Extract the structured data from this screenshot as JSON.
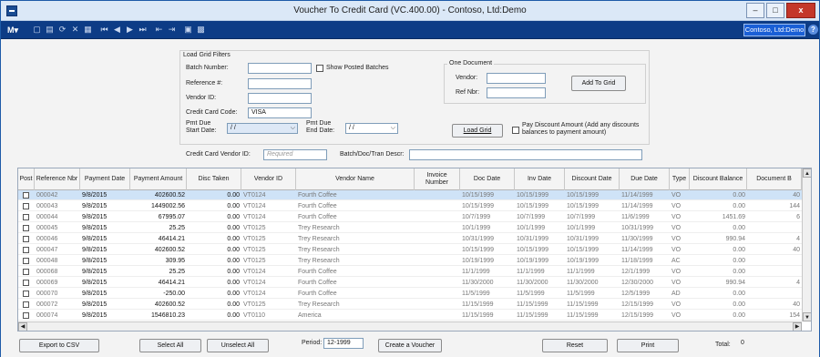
{
  "window": {
    "title": "Voucher To Credit Card (VC.400.00) - Contoso, Ltd:Demo",
    "minimize": "–",
    "maximize": "□",
    "close": "x"
  },
  "toolbar": {
    "logo": "M▾",
    "company": "Contoso, Ltd:Demo",
    "help": "?",
    "icons": [
      "new-icon",
      "save-icon",
      "refresh-icon",
      "delete-icon",
      "cancel-icon",
      "first-icon",
      "previous-icon",
      "next-icon",
      "last-icon",
      "action1-icon",
      "action2-icon",
      "report-icon",
      "export-icon"
    ]
  },
  "filters": {
    "group_label": "Load Grid Filters",
    "batch_number_label": "Batch Number:",
    "batch_number_value": "",
    "show_posted_batches_label": "Show Posted Batches",
    "reference_label": "Reference #:",
    "reference_value": "",
    "vendor_id_label": "Vendor ID:",
    "vendor_id_value": "",
    "credit_card_code_label": "Credit Card Code:",
    "credit_card_code_value": "VISA",
    "pmt_due_start_label1": "Pmt Due",
    "pmt_due_start_label2": "Start Date:",
    "pmt_due_start_value": "/ /",
    "pmt_due_end_label1": "Pmt Due",
    "pmt_due_end_label2": "End Date:",
    "pmt_due_end_value": "/ /",
    "cc_vendor_id_label": "Credit Card Vendor ID:",
    "cc_vendor_id_placeholder": "Required",
    "batch_descr_label": "Batch/Doc/Tran Descr:",
    "batch_descr_value": ""
  },
  "one_document": {
    "group_label": "One Document",
    "vendor_label": "Vendor:",
    "vendor_value": "",
    "ref_nbr_label": "Ref Nbr:",
    "ref_nbr_value": "",
    "add_to_grid": "Add To Grid"
  },
  "load_grid": "Load Grid",
  "pay_discount_label1": "Pay Discount Amount (Add any discounts",
  "pay_discount_label2": "balances to payment amount)",
  "grid": {
    "headers": [
      "Post",
      "Reference Nbr",
      "Payment Date",
      "Payment Amount",
      "Disc Taken",
      "Vendor ID",
      "Vendor Name",
      "Invoice Number",
      "Doc Date",
      "Inv Date",
      "Discount Date",
      "Due Date",
      "Type",
      "Discount Balance",
      "Document B"
    ],
    "rows": [
      {
        "ref": "000042",
        "pay_date": "9/8/2015",
        "pay_amt": "402600.52",
        "disc": "0.00",
        "vendor": "VT0124",
        "name": "Fourth Coffee",
        "inv": "",
        "doc_date": "10/15/1999",
        "inv_date": "10/15/1999",
        "disc_date": "10/15/1999",
        "due_date": "11/14/1999",
        "type": "VO",
        "disc_bal": "0.00",
        "doc_bal": "40"
      },
      {
        "ref": "000043",
        "pay_date": "9/8/2015",
        "pay_amt": "1449002.56",
        "disc": "0.00",
        "vendor": "VT0124",
        "name": "Fourth Coffee",
        "inv": "",
        "doc_date": "10/15/1999",
        "inv_date": "10/15/1999",
        "disc_date": "10/15/1999",
        "due_date": "11/14/1999",
        "type": "VO",
        "disc_bal": "0.00",
        "doc_bal": "144"
      },
      {
        "ref": "000044",
        "pay_date": "9/8/2015",
        "pay_amt": "67995.07",
        "disc": "0.00",
        "vendor": "VT0124",
        "name": "Fourth Coffee",
        "inv": "",
        "doc_date": "10/7/1999",
        "inv_date": "10/7/1999",
        "disc_date": "10/7/1999",
        "due_date": "11/6/1999",
        "type": "VO",
        "disc_bal": "1451.69",
        "doc_bal": "6"
      },
      {
        "ref": "000045",
        "pay_date": "9/8/2015",
        "pay_amt": "25.25",
        "disc": "0.00",
        "vendor": "VT0125",
        "name": "Trey Research",
        "inv": "",
        "doc_date": "10/1/1999",
        "inv_date": "10/1/1999",
        "disc_date": "10/1/1999",
        "due_date": "10/31/1999",
        "type": "VO",
        "disc_bal": "0.00",
        "doc_bal": ""
      },
      {
        "ref": "000046",
        "pay_date": "9/8/2015",
        "pay_amt": "46414.21",
        "disc": "0.00",
        "vendor": "VT0125",
        "name": "Trey Research",
        "inv": "",
        "doc_date": "10/31/1999",
        "inv_date": "10/31/1999",
        "disc_date": "10/31/1999",
        "due_date": "11/30/1999",
        "type": "VO",
        "disc_bal": "990.94",
        "doc_bal": "4"
      },
      {
        "ref": "000047",
        "pay_date": "9/8/2015",
        "pay_amt": "402600.52",
        "disc": "0.00",
        "vendor": "VT0125",
        "name": "Trey Research",
        "inv": "",
        "doc_date": "10/15/1999",
        "inv_date": "10/15/1999",
        "disc_date": "10/15/1999",
        "due_date": "11/14/1999",
        "type": "VO",
        "disc_bal": "0.00",
        "doc_bal": "40"
      },
      {
        "ref": "000048",
        "pay_date": "9/8/2015",
        "pay_amt": "309.95",
        "disc": "0.00",
        "vendor": "VT0125",
        "name": "Trey Research",
        "inv": "",
        "doc_date": "10/19/1999",
        "inv_date": "10/19/1999",
        "disc_date": "10/19/1999",
        "due_date": "11/18/1999",
        "type": "AC",
        "disc_bal": "0.00",
        "doc_bal": ""
      },
      {
        "ref": "000068",
        "pay_date": "9/8/2015",
        "pay_amt": "25.25",
        "disc": "0.00",
        "vendor": "VT0124",
        "name": "Fourth Coffee",
        "inv": "",
        "doc_date": "11/1/1999",
        "inv_date": "11/1/1999",
        "disc_date": "11/1/1999",
        "due_date": "12/1/1999",
        "type": "VO",
        "disc_bal": "0.00",
        "doc_bal": ""
      },
      {
        "ref": "000069",
        "pay_date": "9/8/2015",
        "pay_amt": "46414.21",
        "disc": "0.00",
        "vendor": "VT0124",
        "name": "Fourth Coffee",
        "inv": "",
        "doc_date": "11/30/2000",
        "inv_date": "11/30/2000",
        "disc_date": "11/30/2000",
        "due_date": "12/30/2000",
        "type": "VO",
        "disc_bal": "990.94",
        "doc_bal": "4"
      },
      {
        "ref": "000070",
        "pay_date": "9/8/2015",
        "pay_amt": "-250.00",
        "disc": "0.00",
        "vendor": "VT0124",
        "name": "Fourth Coffee",
        "inv": "",
        "doc_date": "11/5/1999",
        "inv_date": "11/5/1999",
        "disc_date": "11/5/1999",
        "due_date": "12/5/1999",
        "type": "AD",
        "disc_bal": "0.00",
        "doc_bal": ""
      },
      {
        "ref": "000072",
        "pay_date": "9/8/2015",
        "pay_amt": "402600.52",
        "disc": "0.00",
        "vendor": "VT0125",
        "name": "Trey Research",
        "inv": "",
        "doc_date": "11/15/1999",
        "inv_date": "11/15/1999",
        "disc_date": "11/15/1999",
        "due_date": "12/15/1999",
        "type": "VO",
        "disc_bal": "0.00",
        "doc_bal": "40"
      },
      {
        "ref": "000074",
        "pay_date": "9/8/2015",
        "pay_amt": "1546810.23",
        "disc": "0.00",
        "vendor": "VT0110",
        "name": "America",
        "inv": "",
        "doc_date": "11/15/1999",
        "inv_date": "11/15/1999",
        "disc_date": "11/15/1999",
        "due_date": "12/15/1999",
        "type": "VO",
        "disc_bal": "0.00",
        "doc_bal": "154"
      }
    ]
  },
  "bottom": {
    "export_csv": "Export to CSV",
    "select_all": "Select All",
    "unselect_all": "Unselect All",
    "period_label": "Period:",
    "period_value": "12-1999",
    "create_voucher": "Create a Voucher",
    "reset": "Reset",
    "print": "Print",
    "total_label": "Total:",
    "total_value": "0"
  }
}
